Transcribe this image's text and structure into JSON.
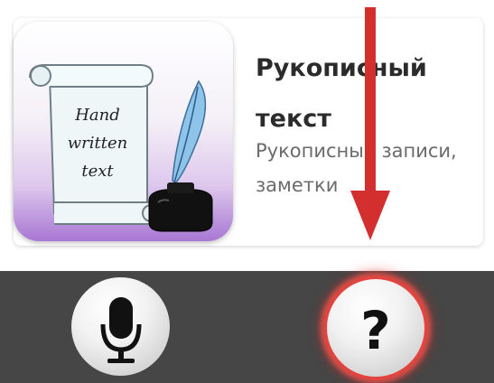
{
  "app_card": {
    "title": "Рукописный текст",
    "description": "Рукописные записи, заметки",
    "icon_caption_line1": "Hand",
    "icon_caption_line2": "written",
    "icon_caption_line3": "text"
  },
  "bottom_bar": {
    "help_label": "?"
  },
  "colors": {
    "arrow": "#d42f2f",
    "help_ring": "#e2453f",
    "bar_background": "#464646"
  }
}
